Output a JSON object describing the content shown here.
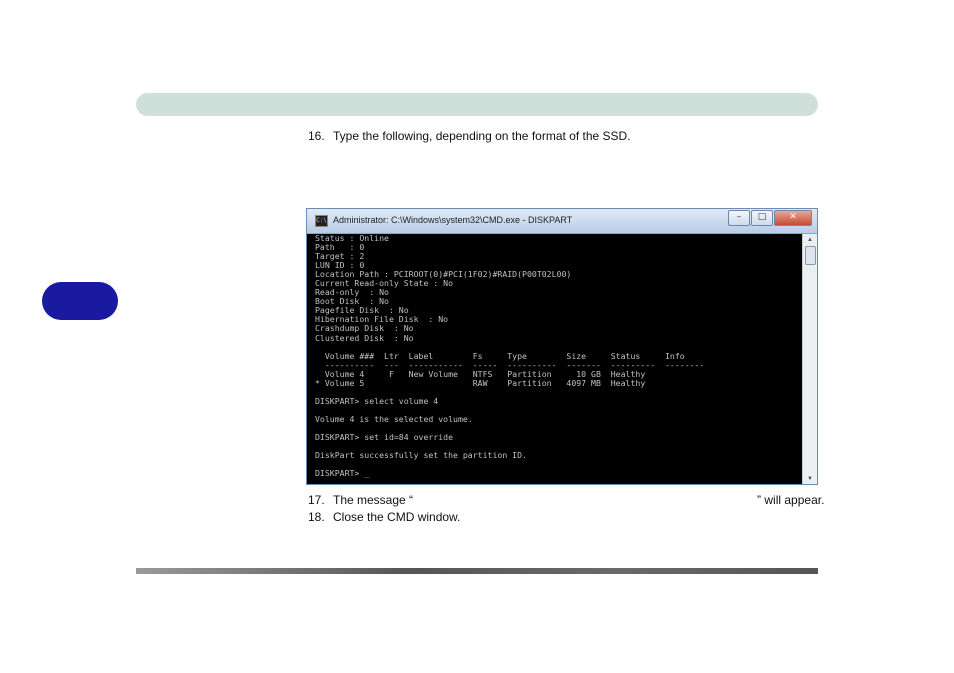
{
  "steps": {
    "step16": {
      "num": "16.",
      "text": "Type the following, depending on the format of the SSD."
    },
    "step17": {
      "num": "17.",
      "prefix": "The message “",
      "suffix": "” will appear."
    },
    "step18": {
      "num": "18.",
      "text": "Close the CMD window."
    }
  },
  "cmd": {
    "icon_label": "C:\\",
    "title": "Administrator: C:\\Windows\\system32\\CMD.exe - DISKPART",
    "minimize": "–",
    "maximize": "□",
    "close": "✕",
    "lines": [
      "Status : Online",
      "Path   : 0",
      "Target : 2",
      "LUN ID : 0",
      "Location Path : PCIROOT(0)#PCI(1F02)#RAID(P00T02L00)",
      "Current Read-only State : No",
      "Read-only  : No",
      "Boot Disk  : No",
      "Pagefile Disk  : No",
      "Hibernation File Disk  : No",
      "Crashdump Disk  : No",
      "Clustered Disk  : No",
      "",
      "  Volume ###  Ltr  Label        Fs     Type        Size     Status     Info",
      "  ----------  ---  -----------  -----  ----------  -------  ---------  --------",
      "  Volume 4     F   New Volume   NTFS   Partition     10 GB  Healthy",
      "* Volume 5                      RAW    Partition   4097 MB  Healthy",
      "",
      "DISKPART> select volume 4",
      "",
      "Volume 4 is the selected volume.",
      "",
      "DISKPART> set id=84 override",
      "",
      "DiskPart successfully set the partition ID.",
      "",
      "DISKPART> _"
    ]
  },
  "colors": {
    "header_bar": "#cfe0da",
    "side_tab": "#1a1aa0",
    "console_bg": "#000000",
    "console_text": "#c0c0c0"
  }
}
